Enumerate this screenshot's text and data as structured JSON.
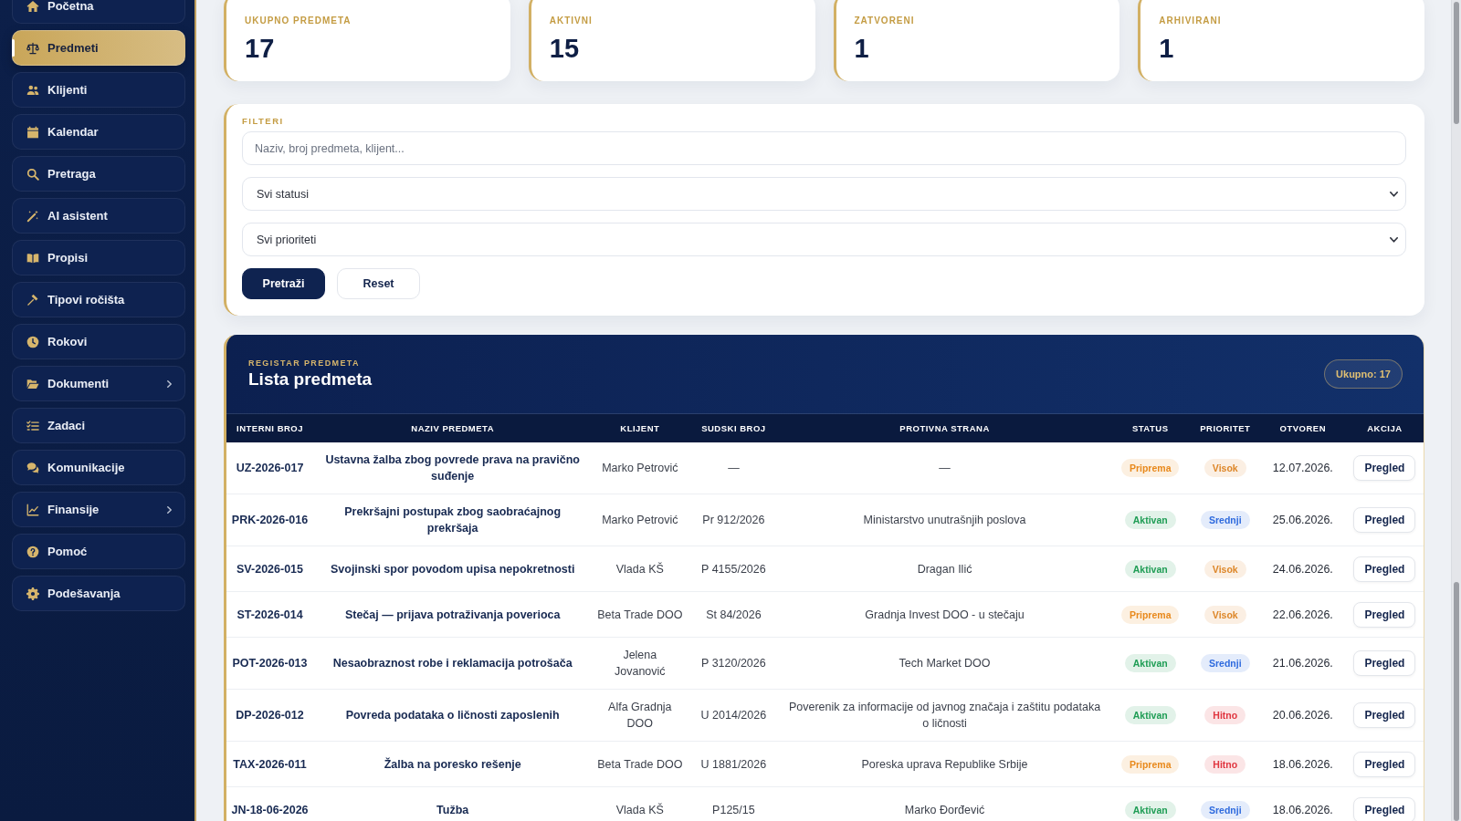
{
  "sidebar": {
    "items": [
      {
        "label": "Početna",
        "selected": false,
        "has_submenu": false
      },
      {
        "label": "Predmeti",
        "selected": true,
        "has_submenu": false
      },
      {
        "label": "Klijenti",
        "selected": false,
        "has_submenu": false
      },
      {
        "label": "Kalendar",
        "selected": false,
        "has_submenu": false
      },
      {
        "label": "Pretraga",
        "selected": false,
        "has_submenu": false
      },
      {
        "label": "AI asistent",
        "selected": false,
        "has_submenu": false
      },
      {
        "label": "Propisi",
        "selected": false,
        "has_submenu": false
      },
      {
        "label": "Tipovi ročišta",
        "selected": false,
        "has_submenu": false
      },
      {
        "label": "Rokovi",
        "selected": false,
        "has_submenu": false
      },
      {
        "label": "Dokumenti",
        "selected": false,
        "has_submenu": true
      },
      {
        "label": "Zadaci",
        "selected": false,
        "has_submenu": false
      },
      {
        "label": "Komunikacije",
        "selected": false,
        "has_submenu": false
      },
      {
        "label": "Finansije",
        "selected": false,
        "has_submenu": true
      },
      {
        "label": "Pomoć",
        "selected": false,
        "has_submenu": false
      },
      {
        "label": "Podešavanja",
        "selected": false,
        "has_submenu": false
      }
    ]
  },
  "stats": [
    {
      "label": "UKUPNO PREDMETA",
      "value": "17"
    },
    {
      "label": "AKTIVNI",
      "value": "15"
    },
    {
      "label": "ZATVORENI",
      "value": "1"
    },
    {
      "label": "ARHIVIRANI",
      "value": "1"
    }
  ],
  "filters": {
    "title": "FILTERI",
    "search": {
      "placeholder": "Naziv, broj predmeta, klijent..."
    },
    "selects": [
      {
        "value": "Svi statusi"
      },
      {
        "value": "Svi prioriteti"
      }
    ],
    "buttons": [
      {
        "label": "Pretraži",
        "kind": "primary"
      },
      {
        "label": "Reset",
        "kind": "secondary"
      }
    ]
  },
  "table": {
    "eyebrow": "REGISTAR PREDMETA",
    "title": "Lista predmeta",
    "total": "Ukupno: 17",
    "columns": [
      "INTERNI BROJ",
      "NAZIV PREDMETA",
      "KLIJENT",
      "SUDSKI BROJ",
      "PROTIVNA STRANA",
      "STATUS",
      "PRIORITET",
      "OTVOREN",
      "AKCIJA"
    ],
    "rows": [
      {
        "interni_broj": "UZ-2026-017",
        "naziv_predmeta": "Ustavna žalba zbog povrede prava na pravično suđenje",
        "klijent": "Marko Petrović",
        "sudski_broj": "—",
        "protivna_strana": "—",
        "status": {
          "label": "Priprema",
          "color": "#e8891c"
        },
        "prioritet": {
          "label": "Visok",
          "color": "#dd8628"
        },
        "otvoren": "12.07.2026.",
        "akcija": "Pregled"
      },
      {
        "interni_broj": "PRK-2026-016",
        "naziv_predmeta": "Prekršajni postupak zbog saobraćajnog prekršaja",
        "klijent": "Marko Petrović",
        "sudski_broj": "Pr 912/2026",
        "protivna_strana": "Ministarstvo unutrašnjih poslova",
        "status": {
          "label": "Aktivan",
          "color": "#1f9d55"
        },
        "prioritet": {
          "label": "Srednji",
          "color": "#2f6bde"
        },
        "otvoren": "25.06.2026.",
        "akcija": "Pregled"
      },
      {
        "interni_broj": "SV-2026-015",
        "naziv_predmeta": "Svojinski spor povodom upisa nepokretnosti",
        "klijent": "Vlada KŠ",
        "sudski_broj": "P 4155/2026",
        "protivna_strana": "Dragan Ilić",
        "status": {
          "label": "Aktivan",
          "color": "#1f9d55"
        },
        "prioritet": {
          "label": "Visok",
          "color": "#dd8628"
        },
        "otvoren": "24.06.2026.",
        "akcija": "Pregled"
      },
      {
        "interni_broj": "ST-2026-014",
        "naziv_predmeta": "Stečaj — prijava potraživanja poverioca",
        "klijent": "Beta Trade DOO",
        "sudski_broj": "St 84/2026",
        "protivna_strana": "Gradnja Invest DOO - u stečaju",
        "status": {
          "label": "Priprema",
          "color": "#e8891c"
        },
        "prioritet": {
          "label": "Visok",
          "color": "#dd8628"
        },
        "otvoren": "22.06.2026.",
        "akcija": "Pregled"
      },
      {
        "interni_broj": "POT-2026-013",
        "naziv_predmeta": "Nesaobraznost robe i reklamacija potrošača",
        "klijent": "Jelena Jovanović",
        "sudski_broj": "P 3120/2026",
        "protivna_strana": "Tech Market DOO",
        "status": {
          "label": "Aktivan",
          "color": "#1f9d55"
        },
        "prioritet": {
          "label": "Srednji",
          "color": "#2f6bde"
        },
        "otvoren": "21.06.2026.",
        "akcija": "Pregled"
      },
      {
        "interni_broj": "DP-2026-012",
        "naziv_predmeta": "Povreda podataka o ličnosti zaposlenih",
        "klijent": "Alfa Gradnja DOO",
        "sudski_broj": "U 2014/2026",
        "protivna_strana": "Poverenik za informacije od javnog značaja i zaštitu podataka o ličnosti",
        "status": {
          "label": "Aktivan",
          "color": "#1f9d55"
        },
        "prioritet": {
          "label": "Hitno",
          "color": "#e0353f"
        },
        "otvoren": "20.06.2026.",
        "akcija": "Pregled"
      },
      {
        "interni_broj": "TAX-2026-011",
        "naziv_predmeta": "Žalba na poresko rešenje",
        "klijent": "Beta Trade DOO",
        "sudski_broj": "U 1881/2026",
        "protivna_strana": "Poreska uprava Republike Srbije",
        "status": {
          "label": "Priprema",
          "color": "#e8891c"
        },
        "prioritet": {
          "label": "Hitno",
          "color": "#e0353f"
        },
        "otvoren": "18.06.2026.",
        "akcija": "Pregled"
      },
      {
        "interni_broj": "JN-18-06-2026",
        "naziv_predmeta": "Tužba",
        "klijent": "Vlada KŠ",
        "sudski_broj": "P125/15",
        "protivna_strana": "Marko Đorđević",
        "status": {
          "label": "Aktivan",
          "color": "#1f9d55"
        },
        "prioritet": {
          "label": "Srednji",
          "color": "#2f6bde"
        },
        "otvoren": "18.06.2026.",
        "akcija": "Pregled"
      }
    ]
  }
}
